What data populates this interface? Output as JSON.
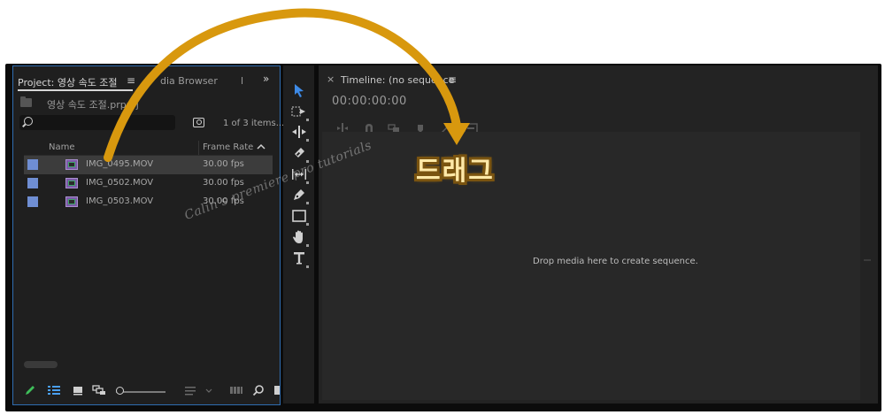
{
  "project_panel": {
    "tab_project": "Project: 영상 속도 조절",
    "tab_media_browser": "dia Browser",
    "tab_partial": "l",
    "tab_overflow": "»",
    "project_file": "영상 속도 조절.prproj",
    "search": {
      "value": "",
      "placeholder": ""
    },
    "item_count": "1 of 3 items...",
    "columns": {
      "name": "Name",
      "frame_rate": "Frame Rate"
    },
    "items": [
      {
        "name": "IMG_0495.MOV",
        "frame_rate": "30.00 fps",
        "selected": true
      },
      {
        "name": "IMG_0502.MOV",
        "frame_rate": "30.00 fps",
        "selected": false
      },
      {
        "name": "IMG_0503.MOV",
        "frame_rate": "30.00 fps",
        "selected": false
      }
    ]
  },
  "tools": [
    "selection-tool",
    "track-select-tool",
    "ripple-edit-tool",
    "razor-tool",
    "slip-tool",
    "pen-tool",
    "rectangle-tool",
    "hand-tool",
    "type-tool"
  ],
  "timeline": {
    "close": "×",
    "title": "Timeline: (no sequence",
    "timecode": "00:00:00:00",
    "drop_message": "Drop media here to create sequence."
  },
  "overlay": {
    "drag_label": "드래그",
    "watermark": "Calin's premiere pro tutorials"
  },
  "colors": {
    "accent": "#2f6cb0",
    "label_blue": "#6f8ed3",
    "arrow": "#d8980e",
    "selection_tool": "#3d8ae6"
  }
}
